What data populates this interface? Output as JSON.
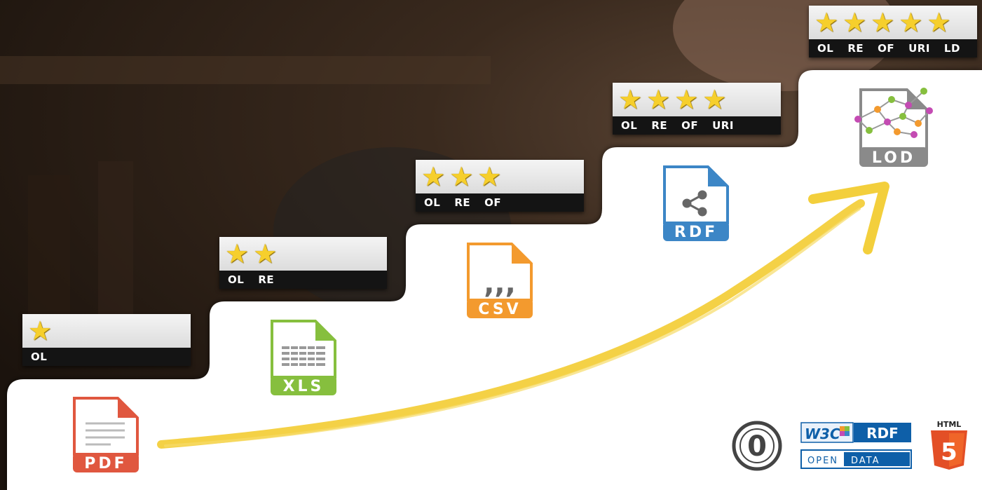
{
  "badges": [
    {
      "stars": 1,
      "labels": [
        "OL"
      ]
    },
    {
      "stars": 2,
      "labels": [
        "OL",
        "RE"
      ]
    },
    {
      "stars": 3,
      "labels": [
        "OL",
        "RE",
        "OF"
      ]
    },
    {
      "stars": 4,
      "labels": [
        "OL",
        "RE",
        "OF",
        "URI"
      ]
    },
    {
      "stars": 5,
      "labels": [
        "OL",
        "RE",
        "OF",
        "URI",
        "LD"
      ]
    }
  ],
  "formats": {
    "pdf": "PDF",
    "xls": "XLS",
    "csv": "CSV",
    "rdf": "RDF",
    "lod": "LOD"
  },
  "logos": {
    "cc0": "0",
    "w3c": "W3C",
    "rdf": "RDF",
    "open": "OPEN",
    "data": "DATA",
    "html": "HTML",
    "html_version": "5"
  },
  "colors": {
    "star": "#f6cf2c",
    "pdf": "#e0573f",
    "xls": "#86bf3e",
    "csv": "#f39a2e",
    "rdf": "#3c86c6",
    "lod": "#8a8a8a",
    "arrow": "#f3cf3c",
    "html5": "#e34f26",
    "w3c_blue": "#0e5fa8"
  }
}
